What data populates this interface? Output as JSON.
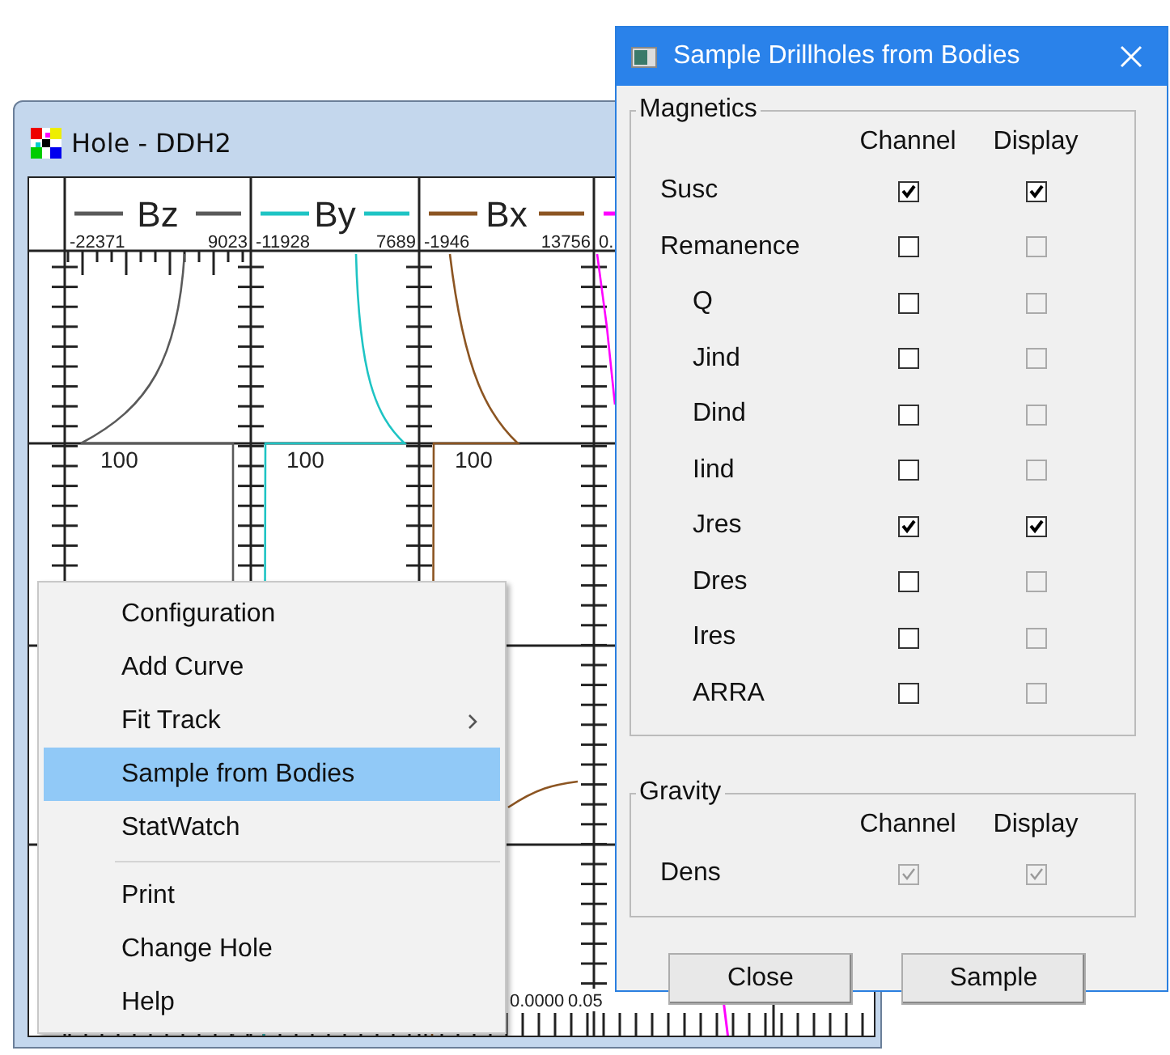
{
  "hole_window": {
    "title": "Hole - DDH2",
    "tracks": [
      {
        "name": "Bz",
        "min": "-22371",
        "max": "9023",
        "color": "#5a5a5a",
        "depth_label": "100"
      },
      {
        "name": "By",
        "min": "-11928",
        "max": "7689",
        "color": "#1ec4c4",
        "depth_label": "100"
      },
      {
        "name": "Bx",
        "min": "-1946",
        "max": "13756",
        "color": "#8c5522",
        "depth_label": "100"
      },
      {
        "min": "0.",
        "color": "#ff00ff"
      }
    ],
    "bottom_labels": [
      "0.0000",
      "0.05"
    ]
  },
  "context_menu": {
    "items": [
      {
        "kind": "item",
        "label": "Configuration",
        "selected": false,
        "submenu": false
      },
      {
        "kind": "item",
        "label": "Add Curve",
        "selected": false,
        "submenu": false
      },
      {
        "kind": "item",
        "label": "Fit Track",
        "selected": false,
        "submenu": true
      },
      {
        "kind": "item",
        "label": "Sample from Bodies",
        "selected": true,
        "submenu": false
      },
      {
        "kind": "item",
        "label": "StatWatch",
        "selected": false,
        "submenu": false
      },
      {
        "kind": "separator"
      },
      {
        "kind": "item",
        "label": "Print",
        "selected": false,
        "submenu": false
      },
      {
        "kind": "item",
        "label": "Change Hole",
        "selected": false,
        "submenu": false
      },
      {
        "kind": "item",
        "label": "Help",
        "selected": false,
        "submenu": false
      }
    ]
  },
  "dialog": {
    "title": "Sample Drillholes from Bodies",
    "groups": [
      {
        "title": "Magnetics",
        "columns": [
          "Channel",
          "Display"
        ],
        "rows": [
          {
            "label": "Susc",
            "channel": {
              "checked": true,
              "disabled": false
            },
            "display": {
              "checked": true,
              "disabled": false
            }
          },
          {
            "label": "Remanence",
            "channel": {
              "checked": false,
              "disabled": false
            },
            "display": {
              "checked": false,
              "disabled": true
            },
            "children": [
              {
                "label": "Q",
                "channel": {
                  "checked": false,
                  "disabled": false
                },
                "display": {
                  "checked": false,
                  "disabled": true
                }
              },
              {
                "label": "Jind",
                "channel": {
                  "checked": false,
                  "disabled": false
                },
                "display": {
                  "checked": false,
                  "disabled": true
                }
              },
              {
                "label": "Dind",
                "channel": {
                  "checked": false,
                  "disabled": false
                },
                "display": {
                  "checked": false,
                  "disabled": true
                }
              },
              {
                "label": "Iind",
                "channel": {
                  "checked": false,
                  "disabled": false
                },
                "display": {
                  "checked": false,
                  "disabled": true
                }
              },
              {
                "label": "Jres",
                "channel": {
                  "checked": true,
                  "disabled": false
                },
                "display": {
                  "checked": true,
                  "disabled": false
                }
              },
              {
                "label": "Dres",
                "channel": {
                  "checked": false,
                  "disabled": false
                },
                "display": {
                  "checked": false,
                  "disabled": true
                }
              },
              {
                "label": "Ires",
                "channel": {
                  "checked": false,
                  "disabled": false
                },
                "display": {
                  "checked": false,
                  "disabled": true
                }
              },
              {
                "label": "ARRA",
                "channel": {
                  "checked": false,
                  "disabled": false
                },
                "display": {
                  "checked": false,
                  "disabled": true
                }
              }
            ]
          }
        ]
      },
      {
        "title": "Gravity",
        "columns": [
          "Channel",
          "Display"
        ],
        "rows": [
          {
            "label": "Dens",
            "channel": {
              "checked": true,
              "disabled": true
            },
            "display": {
              "checked": true,
              "disabled": true
            }
          }
        ]
      }
    ],
    "buttons": [
      "Close",
      "Sample"
    ]
  }
}
